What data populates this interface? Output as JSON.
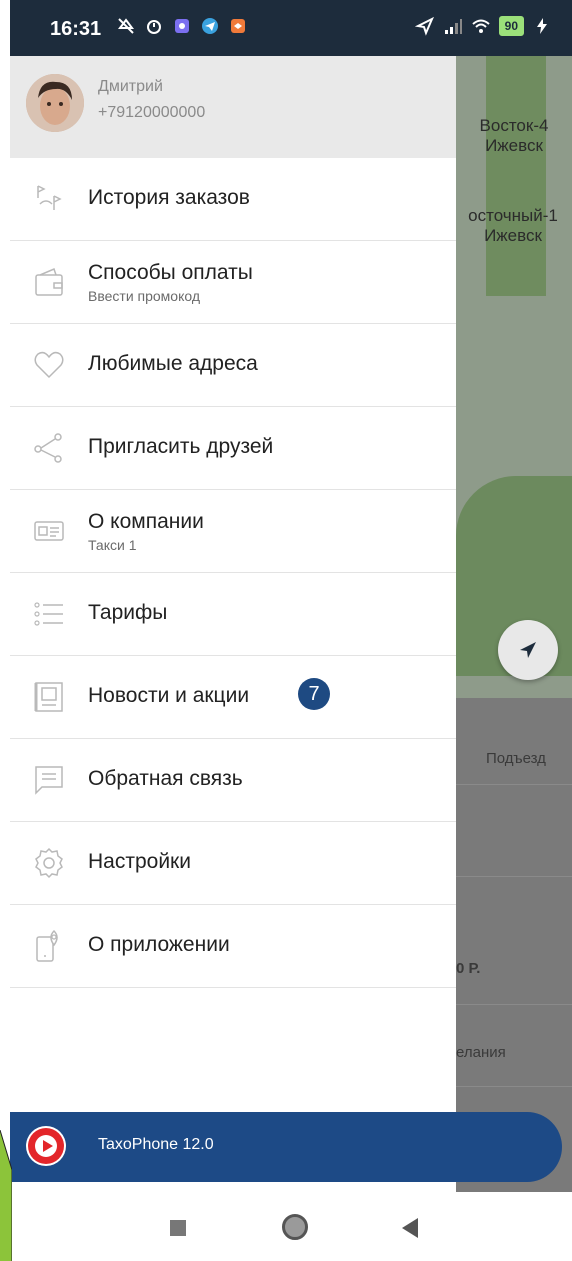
{
  "status_bar": {
    "time": "16:31",
    "battery": "90"
  },
  "map": {
    "label1_line1": "Восток-4",
    "label1_line2": "Ижевск",
    "label2_line1": "осточный-1",
    "label2_line2": "Ижевск",
    "podezd": "Подъезд",
    "price_fragment": "0 Р.",
    "wishes_fragment": "елания"
  },
  "profile": {
    "name": "Дмитрий",
    "phone": "+79120000000"
  },
  "menu": {
    "items": [
      {
        "label": "История заказов",
        "icon": "route-flags-icon"
      },
      {
        "label": "Способы оплаты",
        "sub": "Ввести промокод",
        "icon": "wallet-icon"
      },
      {
        "label": "Любимые адреса",
        "icon": "heart-icon"
      },
      {
        "label": "Пригласить друзей",
        "icon": "share-icon"
      },
      {
        "label": "О компании",
        "sub": "Такси 1",
        "icon": "id-card-icon"
      },
      {
        "label": "Тарифы",
        "icon": "list-icon"
      },
      {
        "label": "Новости и акции",
        "badge": "7",
        "icon": "news-icon"
      },
      {
        "label": "Обратная связь",
        "icon": "message-icon"
      },
      {
        "label": "Настройки",
        "icon": "gear-icon"
      },
      {
        "label": "О приложении",
        "icon": "phone-pin-icon"
      }
    ]
  },
  "banner": {
    "text": "TaxoPhone 12.0"
  },
  "colors": {
    "status_bar": "#1d2c3c",
    "banner": "#1d4a86",
    "badge": "#1e4a82"
  }
}
